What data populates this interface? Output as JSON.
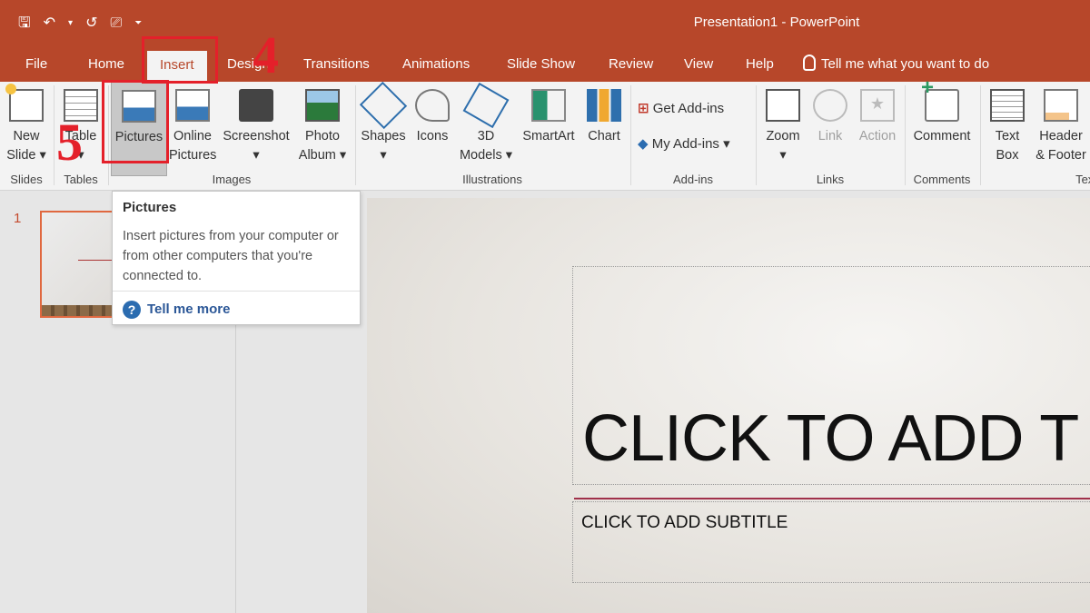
{
  "window": {
    "title": "Presentation1  -  PowerPoint"
  },
  "qat": {
    "save": "🖫",
    "undo": "↶",
    "undo_drop": "▾",
    "redo": "↺",
    "present": "⎚",
    "customize": "⏷"
  },
  "tabs": [
    "File",
    "Home",
    "Insert",
    "Design",
    "Transitions",
    "Animations",
    "Slide Show",
    "Review",
    "View",
    "Help"
  ],
  "tell_me": "Tell me what you want to do",
  "ribbon": {
    "new_slide": [
      "New",
      "Slide ▾"
    ],
    "table": [
      "Table",
      "▾"
    ],
    "pictures": [
      "Pictures",
      ""
    ],
    "online_pictures": [
      "Online",
      "Pictures"
    ],
    "screenshot": [
      "Screenshot",
      "▾"
    ],
    "photo_album": [
      "Photo",
      "Album ▾"
    ],
    "shapes": [
      "Shapes",
      "▾"
    ],
    "icons": [
      "Icons",
      ""
    ],
    "models3d": [
      "3D",
      "Models ▾"
    ],
    "smartart": [
      "SmartArt",
      ""
    ],
    "chart": [
      "Chart",
      ""
    ],
    "get_addins": "Get Add-ins",
    "my_addins": "My Add-ins  ▾",
    "zoom": [
      "Zoom",
      "▾"
    ],
    "link": [
      "Link",
      ""
    ],
    "action": [
      "Action",
      ""
    ],
    "comment": [
      "Comment",
      ""
    ],
    "textbox": [
      "Text",
      "Box"
    ],
    "header_footer": [
      "Header",
      "& Footer"
    ],
    "groups": {
      "slides": "Slides",
      "tables": "Tables",
      "images": "Images",
      "illustrations": "Illustrations",
      "addins": "Add-ins",
      "links": "Links",
      "comments": "Comments",
      "text": "Text"
    }
  },
  "slide_pane": {
    "number": "1"
  },
  "tooltip": {
    "title": "Pictures",
    "description": "Insert pictures from your computer or from other computers that you're connected to.",
    "more": "Tell me more"
  },
  "slide": {
    "title_placeholder": "CLICK TO ADD T",
    "subtitle_placeholder": "CLICK TO ADD SUBTITLE"
  },
  "annotations": {
    "step4": "4",
    "step5": "5"
  },
  "colors": {
    "accent": "#b7472a",
    "annotation": "#e4202a",
    "link": "#2b5797"
  }
}
